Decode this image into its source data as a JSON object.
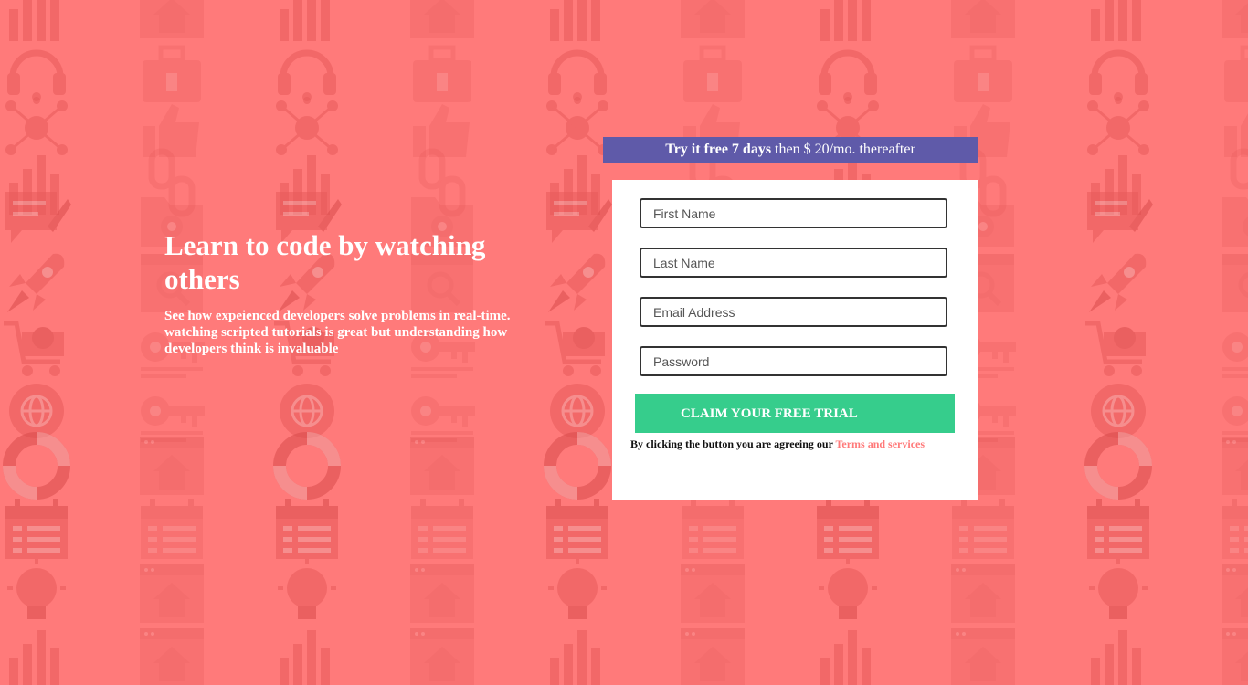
{
  "colors": {
    "background": "#ff7a7a",
    "banner": "#5f5aa9",
    "cta": "#36cd8c",
    "link": "#ff7a7a",
    "pattern_icon": "#e85a5a"
  },
  "background_pattern": {
    "icons": [
      "chart-icon",
      "browser-home-icon",
      "headset-icon",
      "toolbox-icon",
      "network-icon",
      "thumbs-up-icon",
      "link-icon",
      "folder-settings-icon",
      "edit-comment-icon",
      "rocket-icon",
      "search-window-icon",
      "cart-gear-icon",
      "key-icon",
      "globe-gear-icon",
      "life-ring-icon",
      "calendar-icon",
      "idea-bulb-icon"
    ]
  },
  "hero": {
    "title": "Learn to code by watching others",
    "subtitle": "See how expeienced developers solve problems in real-time. watching scripted tutorials is great but understanding how developers think is invaluable"
  },
  "banner": {
    "bold": "Try it free 7 days",
    "rest": " then $ 20/mo. thereafter"
  },
  "form": {
    "first_name_placeholder": "First Name",
    "last_name_placeholder": "Last Name",
    "email_placeholder": "Email Address",
    "password_placeholder": "Password",
    "submit_label": "CLAIM YOUR FREE TRIAL",
    "legal_text": "By clicking the button you are agreeing our ",
    "legal_link": "Terms and services"
  }
}
